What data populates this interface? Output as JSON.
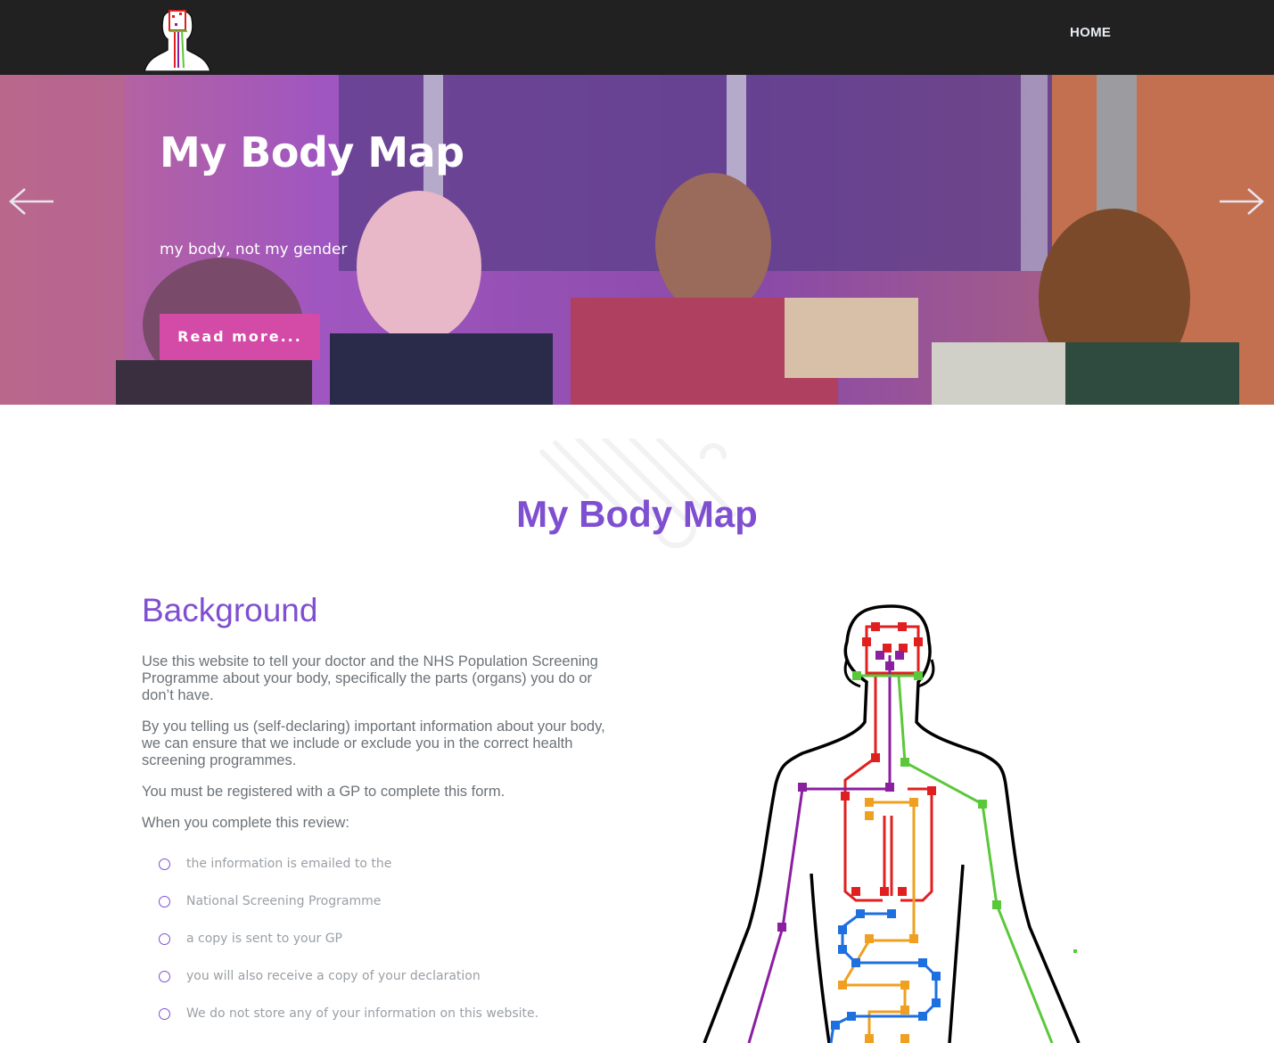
{
  "nav": {
    "logo_icon": "body-map-logo",
    "home_label": "HOME"
  },
  "hero": {
    "title": "My Body Map",
    "subtitle": "my body, not my gender",
    "button_label": "Read more...",
    "prev_icon": "arrow-left-icon",
    "next_icon": "arrow-right-icon"
  },
  "main": {
    "title": "My Body Map",
    "heading": "Background",
    "paragraphs": [
      "Use this website to tell your doctor and the NHS Population Screening Programme about your body, specifically the parts (organs) you do or don’t have.",
      "By you telling us (self-declaring) important information about your body, we can ensure that we include or exclude you in the correct health screening programmes.",
      "You must be registered with a GP to complete this form.",
      "When you complete this review:"
    ],
    "list": [
      "the information is emailed to the",
      "National Screening Programme",
      "a copy is sent to your GP",
      "you will also receive a copy of your declaration",
      "We do not store any of your information on this website."
    ]
  },
  "colors": {
    "navbar": "#212121",
    "accent_purple": "#7f4fd1",
    "button_pink": "#d44aa7",
    "body_text": "#6c7278"
  }
}
